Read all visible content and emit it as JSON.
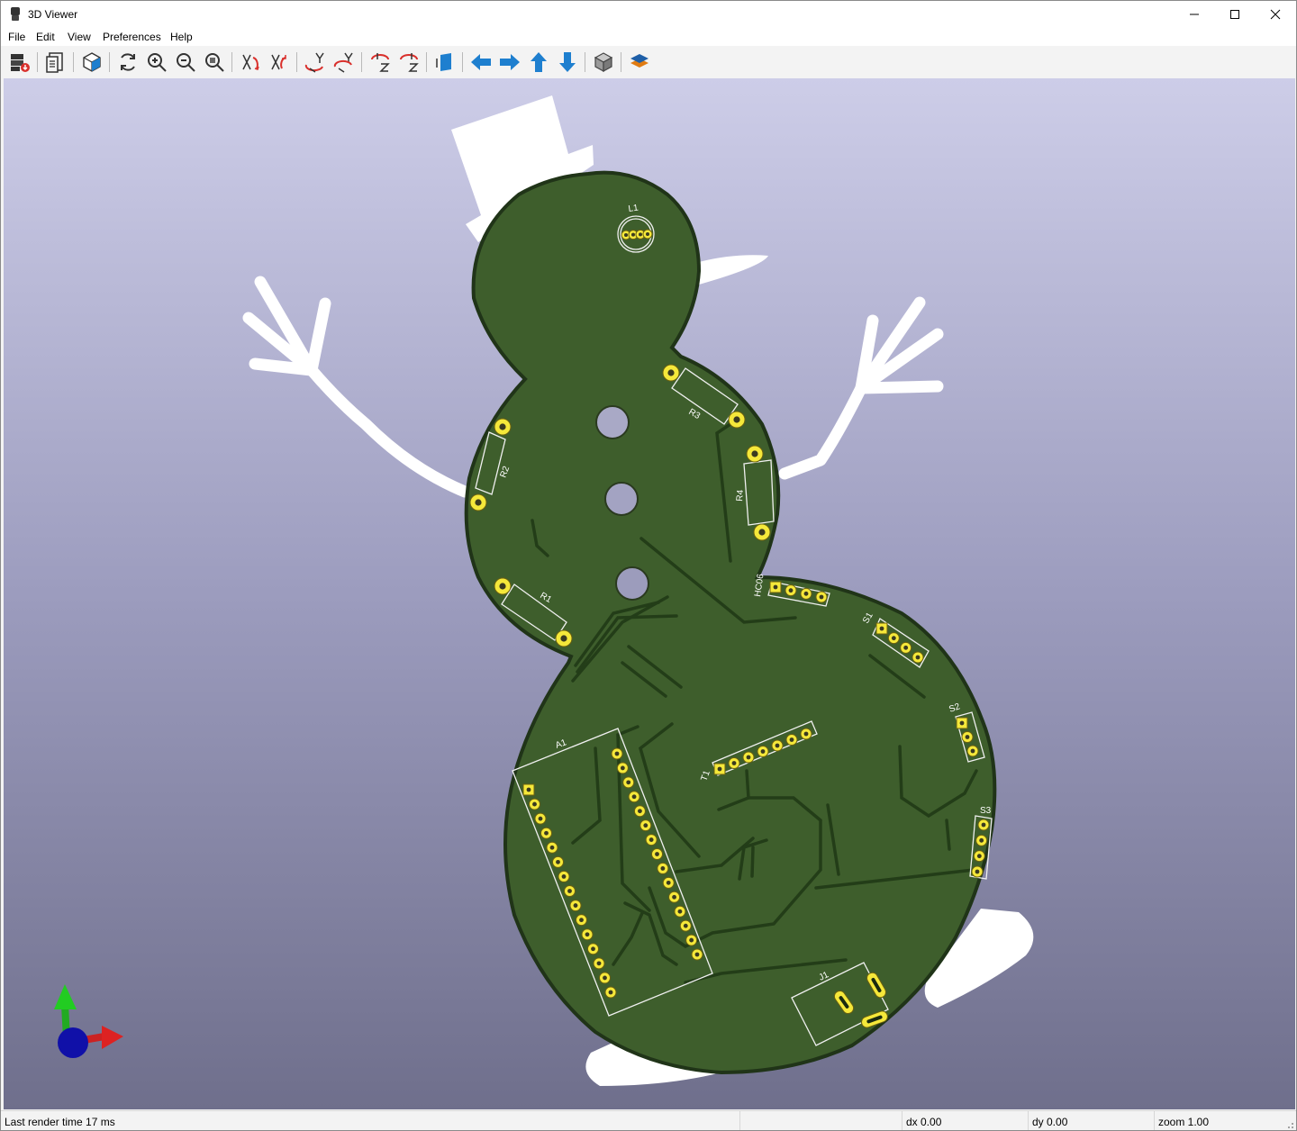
{
  "window": {
    "title": "3D Viewer"
  },
  "menu": [
    "File",
    "Edit",
    "View",
    "Preferences",
    "Help"
  ],
  "toolbar": {
    "buttons": [
      "export-image",
      "copy-to-clipboard",
      "render-options",
      "reload-board",
      "zoom-in",
      "zoom-out",
      "zoom-fit",
      "rotate-x-cw",
      "rotate-x-ccw",
      "rotate-y-cw",
      "rotate-y-ccw",
      "rotate-z-cw",
      "rotate-z-ccw",
      "flip-board",
      "pan-left",
      "pan-right",
      "pan-up",
      "pan-down",
      "projection-toggle",
      "layer-visibility"
    ]
  },
  "board": {
    "refs": {
      "L1": "L1",
      "R1": "R1",
      "R2": "R2",
      "R3": "R3",
      "R4": "R4",
      "HC06": "HC06",
      "S1": "S1",
      "S2": "S2",
      "S3": "S3",
      "A1": "A1",
      "J1": "J1",
      "T1": "T1"
    }
  },
  "status": {
    "render_time": "Last render time 17 ms",
    "dx": "dx 0.00",
    "dy": "dy 0.00",
    "zoom": "zoom 1.00"
  },
  "colors": {
    "pcb_green": "#3e5e2c",
    "pad_gold": "#f5e83a",
    "silkscreen": "#ffffff",
    "accent_blue": "#1e7fcf"
  }
}
